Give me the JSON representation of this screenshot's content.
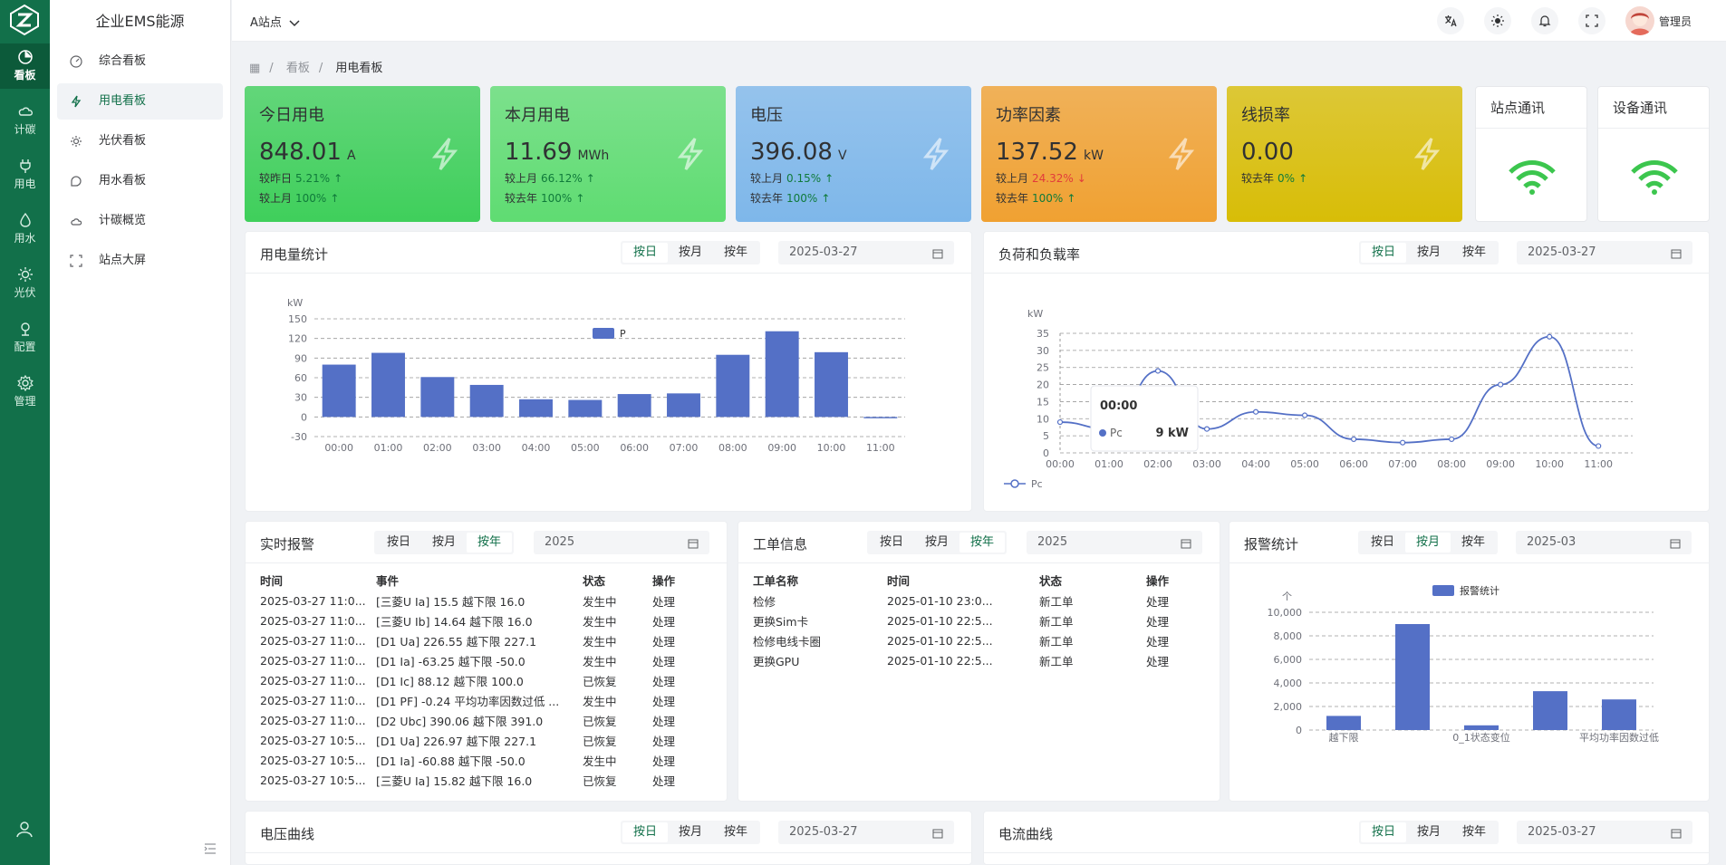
{
  "nav_rail": [
    {
      "label": "看板",
      "icon": "dashboard-icon",
      "active": true
    },
    {
      "label": "计碳",
      "icon": "cloud-icon"
    },
    {
      "label": "用电",
      "icon": "plug-icon"
    },
    {
      "label": "用水",
      "icon": "water-icon"
    },
    {
      "label": "光伏",
      "icon": "sun-icon"
    },
    {
      "label": "配置",
      "icon": "config-icon"
    },
    {
      "label": "管理",
      "icon": "gear-icon"
    }
  ],
  "sidebar": {
    "brand": "企业EMS能源",
    "items": [
      {
        "label": "综合看板",
        "icon": "gauge-icon"
      },
      {
        "label": "用电看板",
        "icon": "lightning-icon",
        "active": true
      },
      {
        "label": "光伏看板",
        "icon": "sun-icon"
      },
      {
        "label": "用水看板",
        "icon": "chat-icon"
      },
      {
        "label": "计碳概览",
        "icon": "cloud-icon"
      },
      {
        "label": "站点大屏",
        "icon": "fullscreen-icon"
      }
    ]
  },
  "header": {
    "site": "A站点",
    "user": "管理员"
  },
  "breadcrumb": [
    "看板",
    "用电看板"
  ],
  "cards": [
    {
      "title": "今日用电",
      "value": "848.01",
      "unit": "A",
      "r1_label": "较昨日",
      "r1_val": "5.21%",
      "r1_dir": "up",
      "r2_label": "较上月",
      "r2_val": "100%",
      "r2_dir": "up",
      "color": "#3fcf5b"
    },
    {
      "title": "本月用电",
      "value": "11.69",
      "unit": "MWh",
      "r1_label": "较上月",
      "r1_val": "66.12%",
      "r1_dir": "up",
      "r2_label": "较去年",
      "r2_val": "100%",
      "r2_dir": "up",
      "color": "#5fdc72"
    },
    {
      "title": "电压",
      "value": "396.08",
      "unit": "V",
      "r1_label": "较上月",
      "r1_val": "0.15%",
      "r1_dir": "up",
      "r2_label": "较去年",
      "r2_val": "100%",
      "r2_dir": "up",
      "color": "#7eb7ea"
    },
    {
      "title": "功率因素",
      "value": "137.52",
      "unit": "kW",
      "r1_label": "较上月",
      "r1_val": "24.32%",
      "r1_dir": "down",
      "r2_label": "较去年",
      "r2_val": "100%",
      "r2_dir": "up",
      "color": "#f0a132"
    },
    {
      "title": "线损率",
      "value": "0.00",
      "unit": "",
      "r1_label": "较去年",
      "r1_val": "0%",
      "r1_dir": "up",
      "r2_label": "",
      "r2_val": "",
      "r2_dir": "",
      "color": "#d8bd07"
    }
  ],
  "comm": [
    {
      "title": "站点通讯"
    },
    {
      "title": "设备通讯"
    }
  ],
  "seg": [
    "按日",
    "按月",
    "按年"
  ],
  "panels": {
    "usage": {
      "title": "用电量统计",
      "date": "2025-03-27"
    },
    "load": {
      "title": "负荷和负载率",
      "date": "2025-03-27"
    },
    "alarm": {
      "title": "实时报警",
      "date": "2025"
    },
    "order": {
      "title": "工单信息",
      "date": "2025"
    },
    "stat": {
      "title": "报警统计",
      "date": "2025-03"
    },
    "volt": {
      "title": "电压曲线",
      "date": "2025-03-27"
    },
    "curr": {
      "title": "电流曲线",
      "date": "2025-03-27"
    }
  },
  "alarm_table": {
    "columns": [
      "时间",
      "事件",
      "状态",
      "操作"
    ],
    "rows": [
      [
        "2025-03-27 11:0...",
        "[三菱U Ia] 15.5 越下限 16.0",
        "发生中",
        "处理"
      ],
      [
        "2025-03-27 11:0...",
        "[三菱U Ib] 14.64 越下限 16.0",
        "发生中",
        "处理"
      ],
      [
        "2025-03-27 11:0...",
        "[D1 Ua] 226.55 越下限 227.1",
        "发生中",
        "处理"
      ],
      [
        "2025-03-27 11:0...",
        "[D1 Ia] -63.25 越下限 -50.0",
        "发生中",
        "处理"
      ],
      [
        "2025-03-27 11:0...",
        "[D1 Ic] 88.12 越下限 100.0",
        "已恢复",
        "处理"
      ],
      [
        "2025-03-27 11:0...",
        "[D1 PF] -0.24 平均功率因数过低 ...",
        "发生中",
        "处理"
      ],
      [
        "2025-03-27 11:0...",
        "[D2 Ubc] 390.06 越下限 391.0",
        "已恢复",
        "处理"
      ],
      [
        "2025-03-27 10:5...",
        "[D1 Ua] 226.97 越下限 227.1",
        "已恢复",
        "处理"
      ],
      [
        "2025-03-27 10:5...",
        "[D1 Ia] -60.88 越下限 -50.0",
        "发生中",
        "处理"
      ],
      [
        "2025-03-27 10:5...",
        "[三菱U Ia] 15.82 越下限 16.0",
        "已恢复",
        "处理"
      ]
    ]
  },
  "order_table": {
    "columns": [
      "工单名称",
      "时间",
      "状态",
      "操作"
    ],
    "rows": [
      [
        "检修",
        "2025-01-10 23:0...",
        "新工单",
        "处理"
      ],
      [
        "更换Sim卡",
        "2025-01-10 22:5...",
        "新工单",
        "处理"
      ],
      [
        "检修电线卡圈",
        "2025-01-10 22:5...",
        "新工单",
        "处理"
      ],
      [
        "更换GPU",
        "2025-01-10 22:5...",
        "新工单",
        "处理"
      ]
    ]
  },
  "chart_data": [
    {
      "type": "bar",
      "legend": "P",
      "ylabel": "kW",
      "ylim": [
        -30,
        150
      ],
      "yticks": [
        -30,
        0,
        30,
        60,
        90,
        120,
        150
      ],
      "categories": [
        "00:00",
        "01:00",
        "02:00",
        "03:00",
        "04:00",
        "05:00",
        "06:00",
        "07:00",
        "08:00",
        "09:00",
        "10:00",
        "11:00"
      ],
      "values": [
        80,
        98,
        61,
        49,
        27,
        26,
        35,
        36,
        95,
        131,
        99,
        -2
      ],
      "color": "#5470c6"
    },
    {
      "type": "line",
      "legend": "Pc",
      "ylabel": "kW",
      "ylim": [
        0,
        35
      ],
      "yticks": [
        0,
        5,
        10,
        15,
        20,
        25,
        30,
        35
      ],
      "categories": [
        "00:00",
        "01:00",
        "02:00",
        "03:00",
        "04:00",
        "05:00",
        "06:00",
        "07:00",
        "08:00",
        "09:00",
        "10:00",
        "11:00"
      ],
      "values": [
        9,
        7,
        24,
        7,
        12,
        11,
        4,
        3,
        4,
        20,
        34,
        2
      ],
      "tooltip": {
        "time": "00:00",
        "series": "Pc",
        "value": "9 kW"
      },
      "color": "#5470c6"
    },
    {
      "type": "bar",
      "legend": "报警统计",
      "ylabel": "个",
      "ylim": [
        0,
        10000
      ],
      "yticks": [
        0,
        2000,
        4000,
        6000,
        8000,
        10000
      ],
      "categories": [
        "越下限",
        "",
        "0_1状态变位",
        "",
        "平均功率因数过低"
      ],
      "values": [
        1200,
        9000,
        400,
        3300,
        2600
      ],
      "color": "#5470c6"
    }
  ]
}
